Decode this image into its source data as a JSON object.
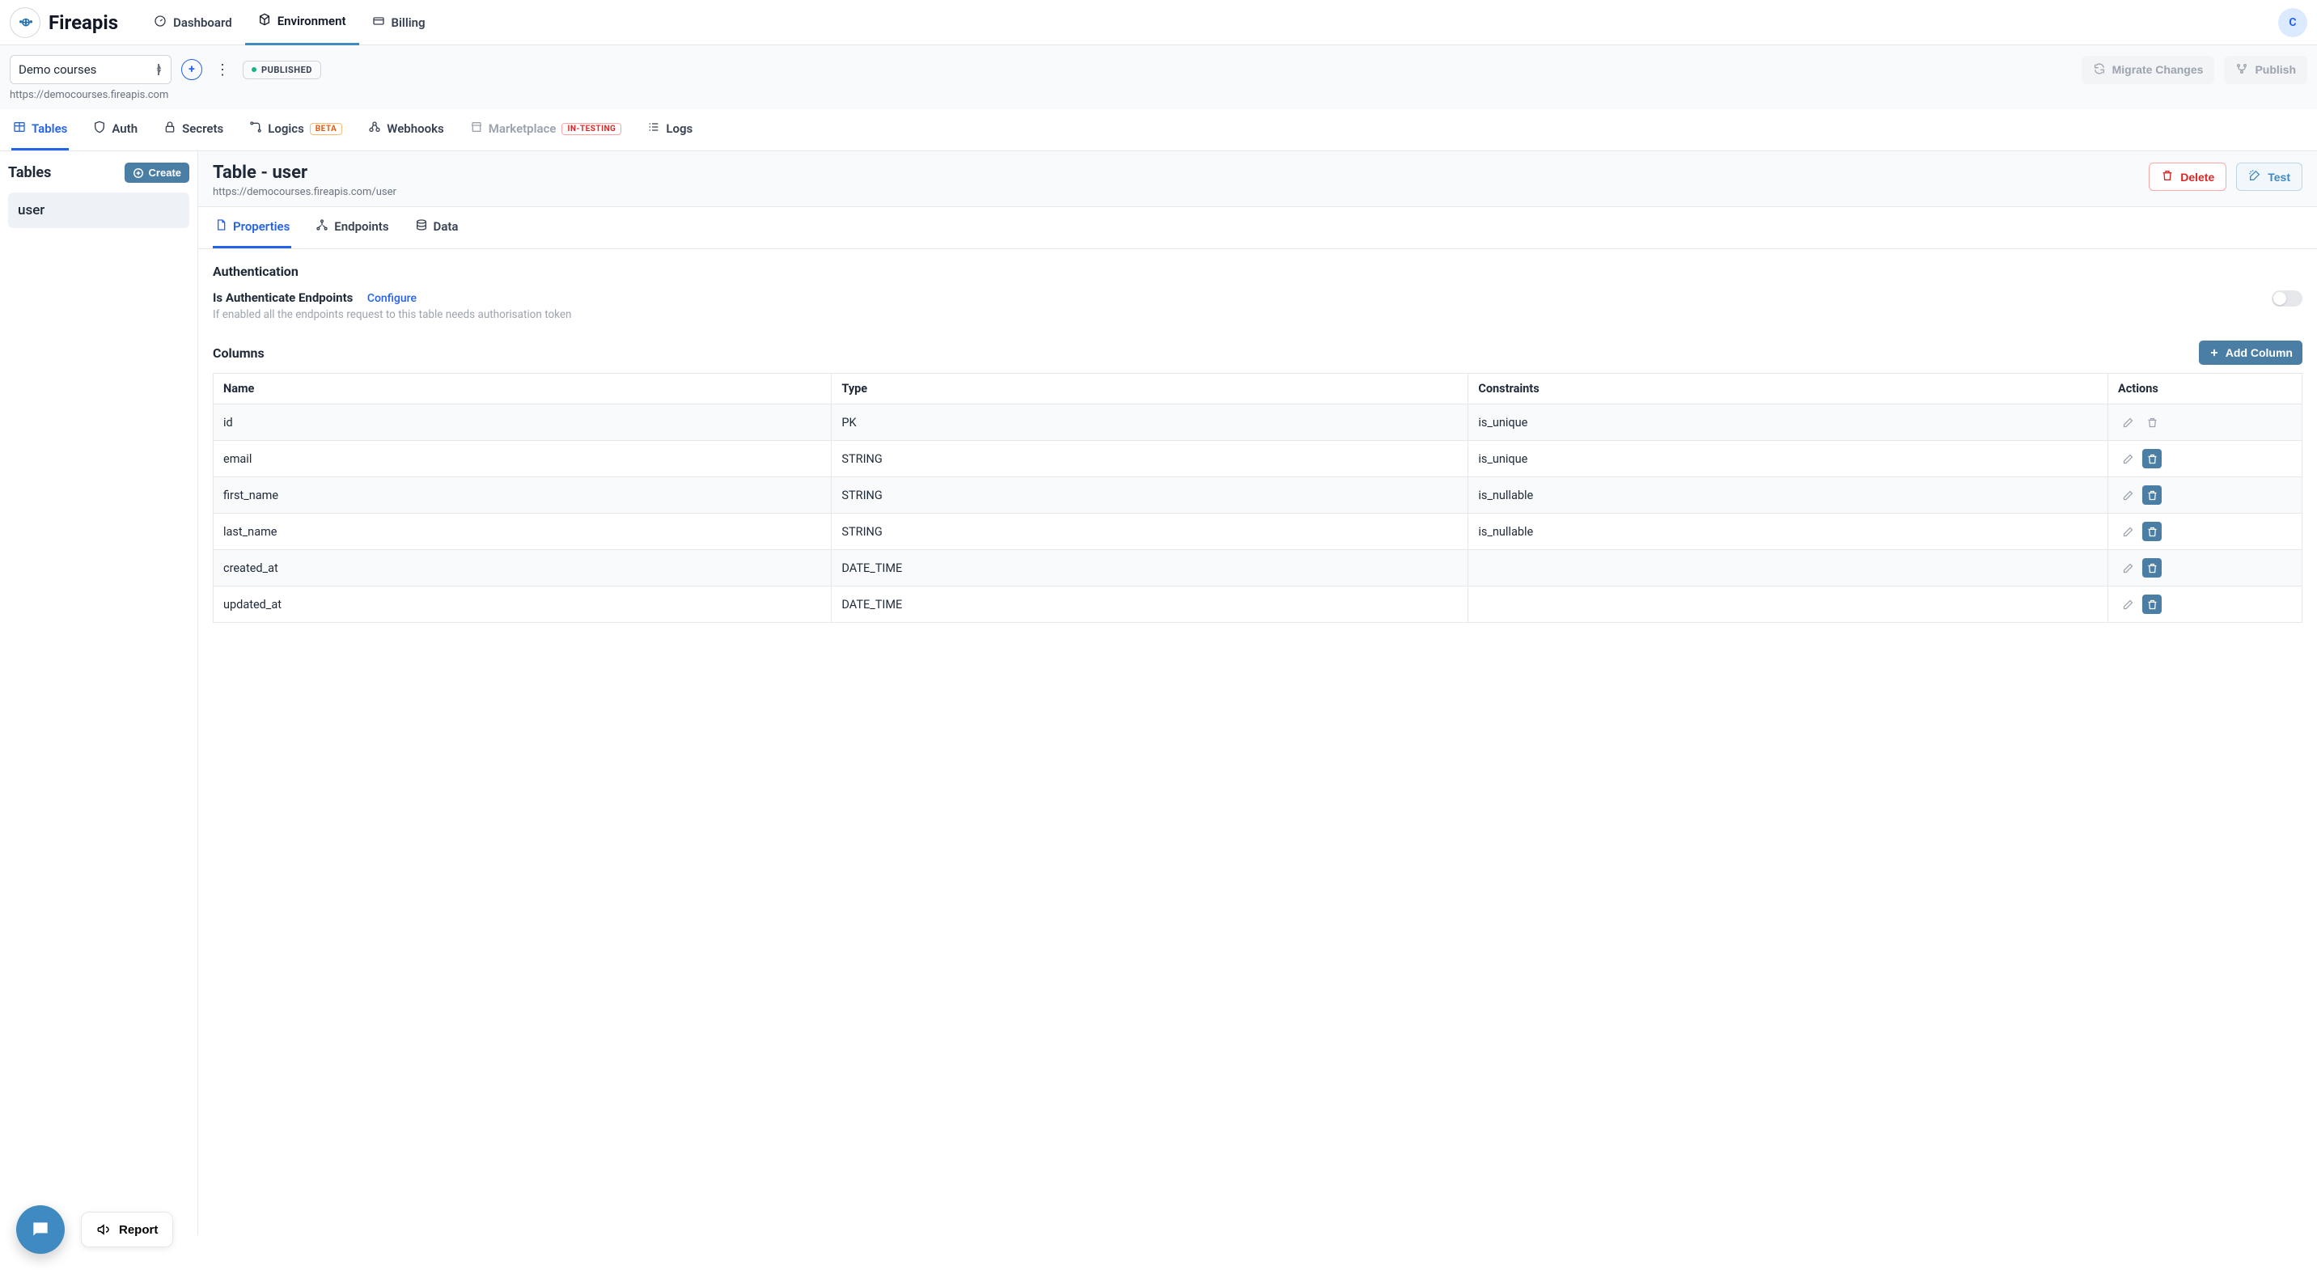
{
  "brand": "Fireapis",
  "avatar_initial": "C",
  "topnav": {
    "dashboard": "Dashboard",
    "environment": "Environment",
    "billing": "Billing"
  },
  "toolbar": {
    "project_selected": "Demo courses",
    "status_label": "PUBLISHED",
    "migrate_label": "Migrate Changes",
    "publish_label": "Publish",
    "base_url": "https://democourses.fireapis.com"
  },
  "env_tabs": {
    "tables": "Tables",
    "auth": "Auth",
    "secrets": "Secrets",
    "logics": "Logics",
    "logics_badge": "BETA",
    "webhooks": "Webhooks",
    "marketplace": "Marketplace",
    "marketplace_badge": "IN-TESTING",
    "logs": "Logs"
  },
  "sidebar": {
    "title": "Tables",
    "create_label": "Create",
    "items": [
      "user"
    ]
  },
  "content": {
    "title": "Table - user",
    "url": "https://democourses.fireapis.com/user",
    "delete_label": "Delete",
    "test_label": "Test"
  },
  "sub_tabs": {
    "properties": "Properties",
    "endpoints": "Endpoints",
    "data": "Data"
  },
  "auth_section": {
    "heading": "Authentication",
    "label": "Is Authenticate Endpoints",
    "configure": "Configure",
    "desc": "If enabled all the endpoints request to this table needs authorisation token"
  },
  "columns_section": {
    "heading": "Columns",
    "add_label": "Add Column",
    "headers": {
      "name": "Name",
      "type": "Type",
      "constraints": "Constraints",
      "actions": "Actions"
    },
    "rows": [
      {
        "name": "id",
        "type": "PK",
        "constraints": "is_unique",
        "deletable": false
      },
      {
        "name": "email",
        "type": "STRING",
        "constraints": "is_unique",
        "deletable": true
      },
      {
        "name": "first_name",
        "type": "STRING",
        "constraints": "is_nullable",
        "deletable": true
      },
      {
        "name": "last_name",
        "type": "STRING",
        "constraints": "is_nullable",
        "deletable": true
      },
      {
        "name": "created_at",
        "type": "DATE_TIME",
        "constraints": "",
        "deletable": true
      },
      {
        "name": "updated_at",
        "type": "DATE_TIME",
        "constraints": "",
        "deletable": true
      }
    ]
  },
  "floating": {
    "report": "Report"
  }
}
